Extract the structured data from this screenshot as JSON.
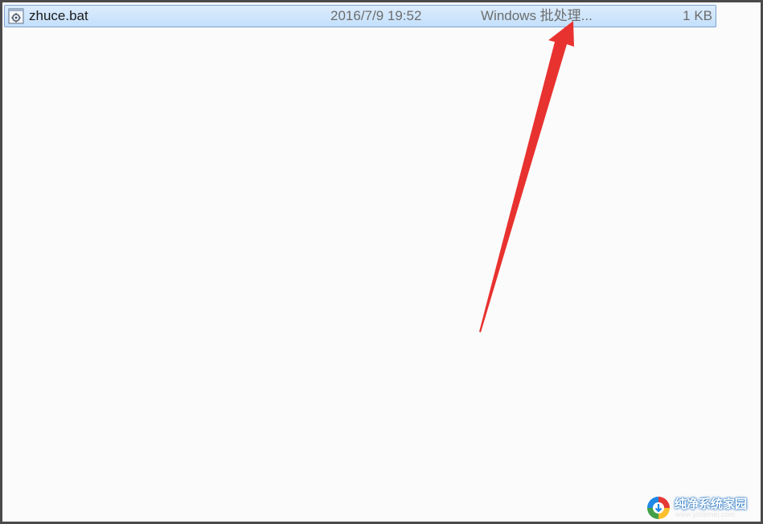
{
  "file_row": {
    "name": "zhuce.bat",
    "date_modified": "2016/7/9 19:52",
    "type": "Windows 批处理...",
    "size": "1 KB",
    "icon": "batch-file-gear-icon"
  },
  "annotation": {
    "arrow_color": "#e8322f"
  },
  "watermark": {
    "title": "纯净系统家园",
    "url": "www.yidaimei.com"
  },
  "colors": {
    "selection_fill": "#cce4fc",
    "selection_border": "#7da2ce",
    "pane_background": "#fbfbfb"
  }
}
